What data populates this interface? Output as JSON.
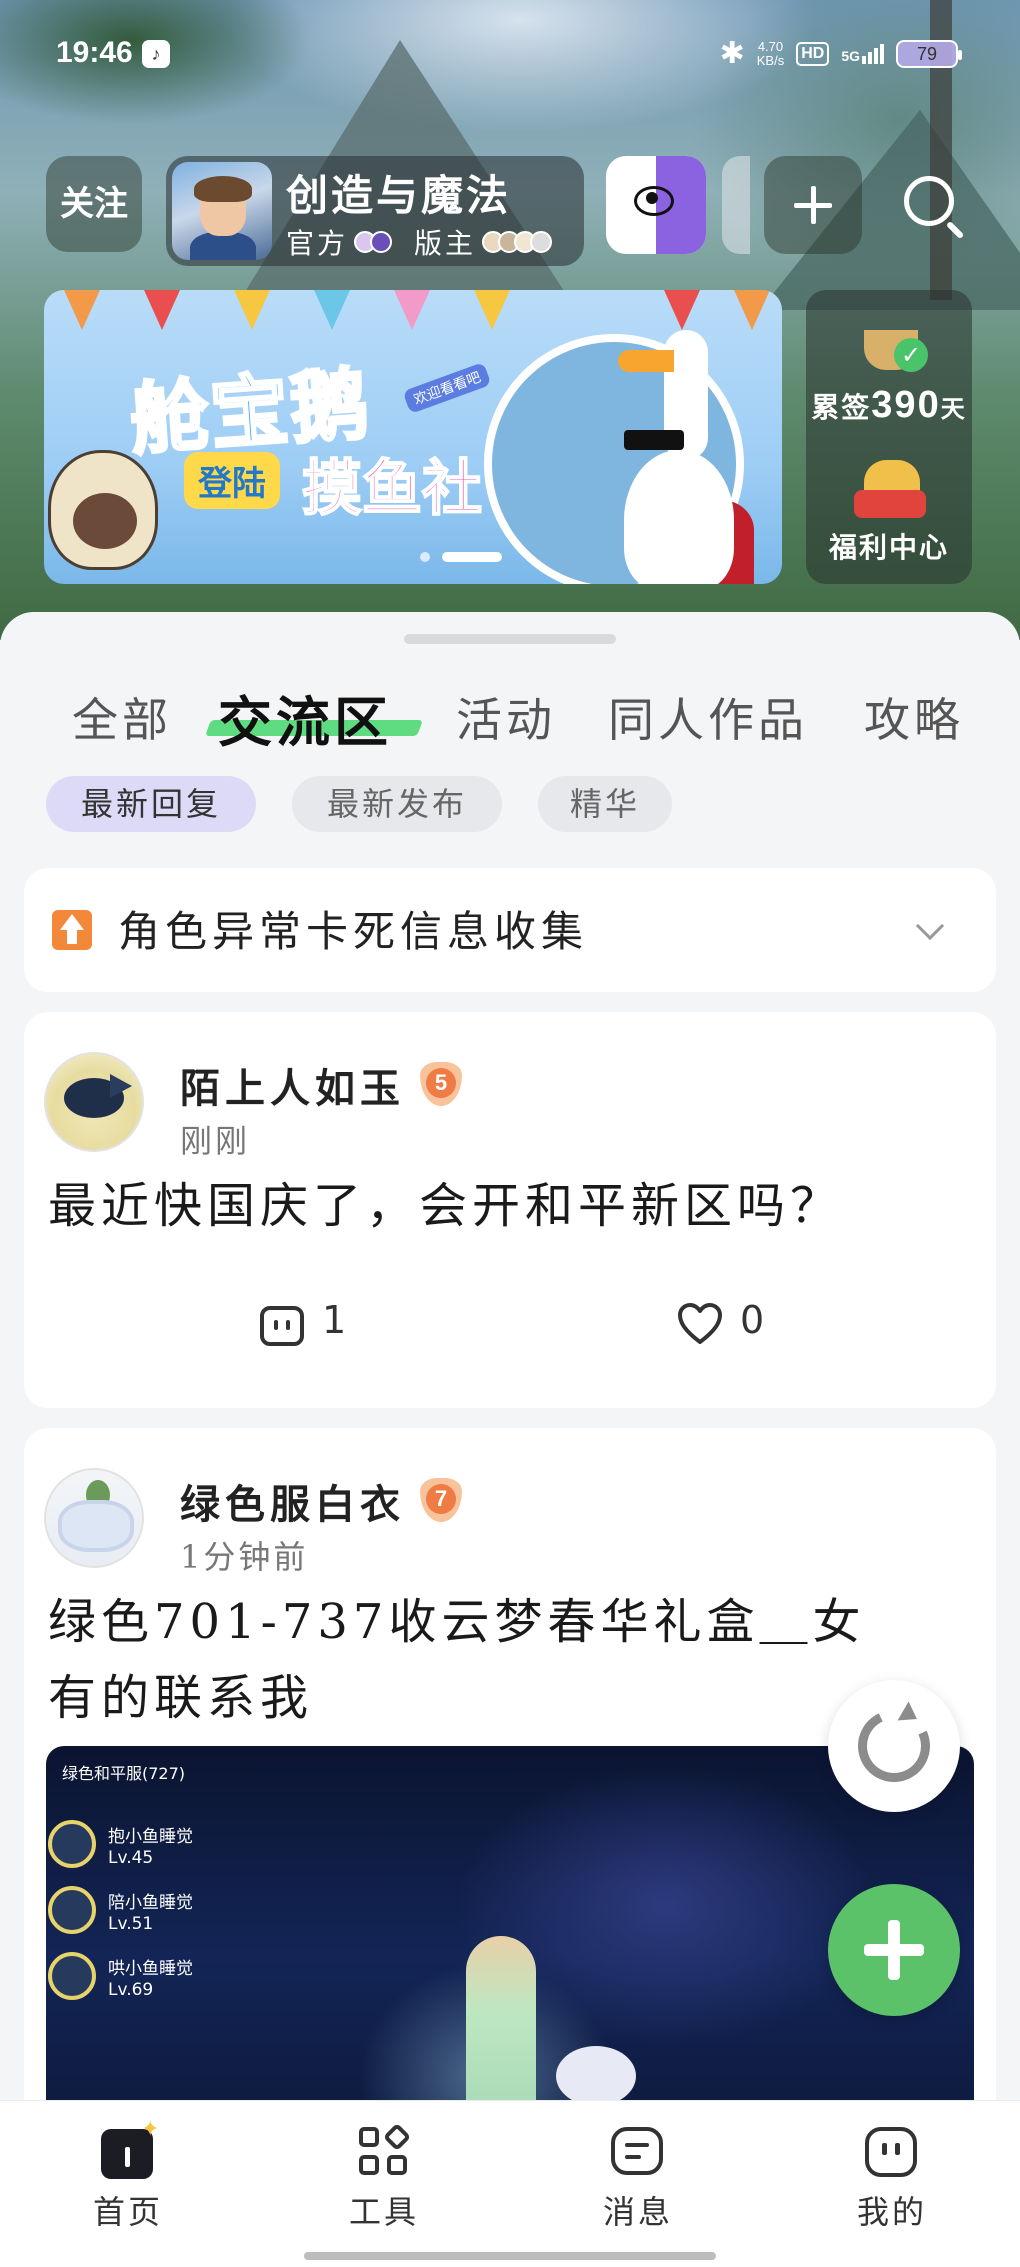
{
  "status_bar": {
    "time": "19:46",
    "net_speed_value": "4.70",
    "net_speed_unit": "KB/s",
    "hd": "HD",
    "network": "5G",
    "battery": "79"
  },
  "header": {
    "follow_label": "关注",
    "game_title": "创造与魔法",
    "official_label": "官方",
    "moderator_label": "版主"
  },
  "banner": {
    "title": "舱宝鹅",
    "subtitle_small": "登陆",
    "subtitle_big": "摸鱼社",
    "badge": "欢迎看看吧",
    "page_count": 2,
    "active_page": 2
  },
  "side_panel": {
    "sign_prefix": "累签",
    "sign_days": "390",
    "sign_suffix": "天",
    "welfare_label": "福利中心"
  },
  "tabs": [
    "全部",
    "交流区",
    "活动",
    "同人作品",
    "攻略"
  ],
  "active_tab": "交流区",
  "chips": [
    "最新回复",
    "最新发布",
    "精华"
  ],
  "active_chip": "最新回复",
  "notice": {
    "text": "角色异常卡死信息收集"
  },
  "posts": [
    {
      "username": "陌上人如玉",
      "level": "5",
      "time": "刚刚",
      "text": "最近快国庆了，会开和平新区吗？",
      "comments": "1",
      "likes": "0"
    },
    {
      "username": "绿色服白衣",
      "level": "7",
      "time": "1分钟前",
      "text_line1": "绿色701-737收云梦春华礼盒＿女",
      "text_line2": "有的联系我",
      "image": {
        "header": "绿色和平服(727)",
        "members": [
          {
            "name": "抱小鱼睡觉",
            "level": "Lv.45"
          },
          {
            "name": "陪小鱼睡觉",
            "level": "Lv.51"
          },
          {
            "name": "哄小鱼睡觉",
            "level": "Lv.69"
          }
        ]
      }
    }
  ],
  "bottom_nav": [
    "首页",
    "工具",
    "消息",
    "我的"
  ],
  "colors": {
    "accent_green": "#5cc26a",
    "tab_underline": "#5fdc82",
    "chip_active": "#dcdaf7",
    "notice_icon": "#f4883a"
  }
}
